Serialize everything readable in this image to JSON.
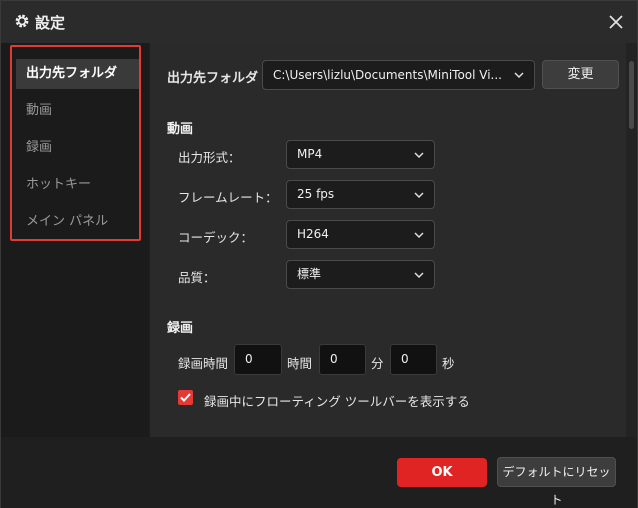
{
  "window": {
    "title": "設定",
    "title_icon": "gear-icon",
    "close_icon": "close-icon"
  },
  "sidebar": {
    "items": [
      {
        "label": "出力先フォルダ",
        "active": true
      },
      {
        "label": "動画",
        "active": false
      },
      {
        "label": "録画",
        "active": false
      },
      {
        "label": "ホットキー",
        "active": false
      },
      {
        "label": "メイン パネル",
        "active": false
      }
    ]
  },
  "output": {
    "label": "出力先フォルダ",
    "path": "C:\\Users\\lizlu\\Documents\\MiniTool Vi...",
    "change_button": "変更"
  },
  "video": {
    "section_title": "動画",
    "format_label": "出力形式：",
    "format_value": "MP4",
    "framerate_label": "フレームレート：",
    "framerate_value": "25 fps",
    "codec_label": "コーデック：",
    "codec_value": "H264",
    "quality_label": "品質：",
    "quality_value": "標準"
  },
  "recording": {
    "section_title": "録画",
    "duration_label": "録画時間",
    "hours": "0",
    "hours_unit": "時間",
    "minutes": "0",
    "minutes_unit": "分",
    "seconds": "0",
    "seconds_unit": "秒",
    "toolbar_checkbox_label": "録画中にフローティング ツールバーを表示する",
    "toolbar_checkbox_checked": true
  },
  "footer": {
    "ok_button": "OK",
    "reset_button": "デフォルトにリセット"
  },
  "colors": {
    "accent": "#e02424",
    "highlight_border": "#e53935"
  }
}
